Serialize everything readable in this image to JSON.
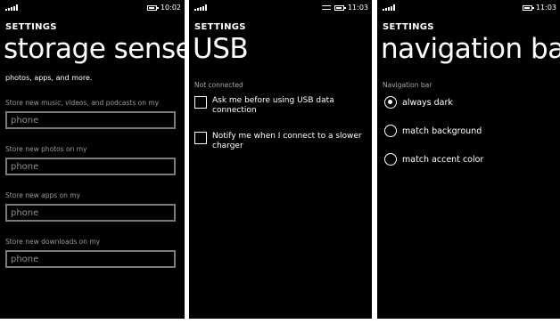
{
  "panels": [
    {
      "status": {
        "time": "10:02"
      },
      "app_title": "SETTINGS",
      "page_title": "storage sense",
      "clipped_text": "photos, apps, and more.",
      "fields": [
        {
          "label": "Store new music, videos, and podcasts on my",
          "value": "phone"
        },
        {
          "label": "Store new photos on my",
          "value": "phone"
        },
        {
          "label": "Store new apps on my",
          "value": "phone"
        },
        {
          "label": "Store new downloads on my",
          "value": "phone"
        }
      ]
    },
    {
      "status": {
        "time": "11:03"
      },
      "app_title": "SETTINGS",
      "page_title": "USB",
      "section_label": "Not connected",
      "checkboxes": [
        {
          "label": "Ask me before using USB data connection",
          "checked": false
        },
        {
          "label": "Notify me when I connect to a slower charger",
          "checked": false
        }
      ]
    },
    {
      "status": {
        "time": "11:03"
      },
      "app_title": "SETTINGS",
      "page_title": "navigation bar",
      "section_label": "Navigation bar",
      "radios": [
        {
          "label": "always dark",
          "checked": true
        },
        {
          "label": "match background",
          "checked": false
        },
        {
          "label": "match accent color",
          "checked": false
        }
      ]
    }
  ],
  "colors": {
    "background": "#000000",
    "separator": "#ffffff",
    "text": "#ffffff",
    "muted_text": "#9a9a9a",
    "field_border": "#7a7a7a"
  }
}
